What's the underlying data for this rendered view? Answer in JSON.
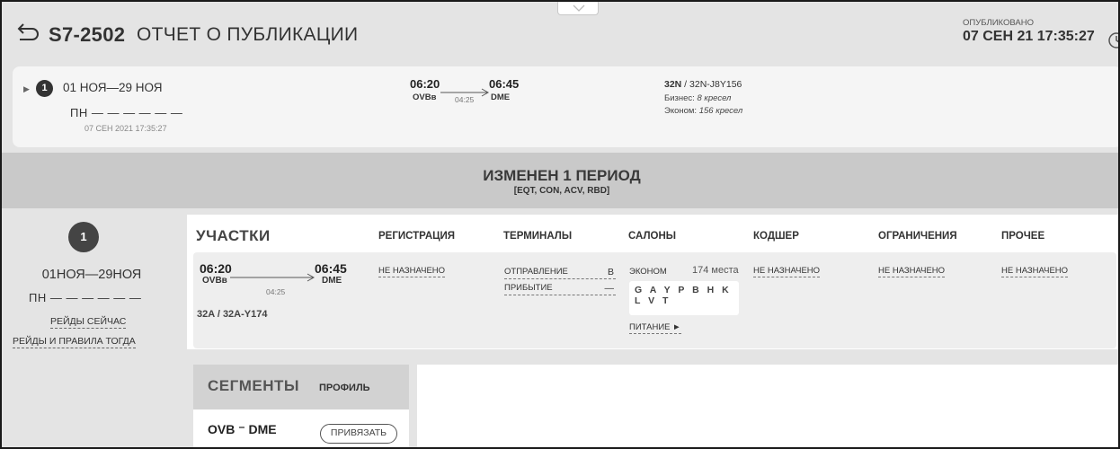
{
  "header": {
    "flight_code": "S7-2502",
    "title": "ОТЧЕТ О ПУБЛИКАЦИИ",
    "published_label": "ОПУБЛИКОВАНО",
    "published_date": "07 СЕН 21 17:35:27"
  },
  "period_card": {
    "number": "1",
    "dates": "01 НОЯ—29 НОЯ",
    "days": "ПН — — — — — —",
    "published": "07 СЕН 2021 17:35:27",
    "departure_time": "06:20",
    "departure_airport": "OVBв",
    "duration": "04:25",
    "arrival_time": "06:45",
    "arrival_airport": "DME",
    "aircraft_code": "32N",
    "aircraft_config": " / 32N-J8Y156",
    "business_label": "Бизнес: ",
    "business_value": "8 кресел",
    "economy_label": "Эконом: ",
    "economy_value": "156 кресел"
  },
  "changes": {
    "title": "ИЗМЕНЕН 1 ПЕРИОД",
    "codes": "[EQT, CON, ACV, RBD]"
  },
  "period": {
    "number": "1",
    "dates": "01НОЯ—29НОЯ",
    "days": "ПН — — — — — —",
    "flights_now": "РЕЙДЫ СЕЙЧАС",
    "flights_then": "РЕЙДЫ И ПРАВИЛА ТОГДА"
  },
  "columns": {
    "legs": "УЧАСТКИ",
    "checkin": "РЕГИСТРАЦИЯ",
    "terminals": "ТЕРМИНАЛЫ",
    "cabins": "САЛОНЫ",
    "codeshare": "КОДШЕР",
    "restrictions": "ОГРАНИЧЕНИЯ",
    "other": "ПРОЧЕЕ"
  },
  "leg": {
    "departure_time": "06:20",
    "departure_airport": "OVBв",
    "duration": "04:25",
    "arrival_time": "06:45",
    "arrival_airport": "DME",
    "aircraft": "32A / 32A-Y174",
    "checkin": "НЕ НАЗНАЧЕНО",
    "terminal_departure_label": "ОТПРАВЛЕНИЕ",
    "terminal_departure_value": "B",
    "terminal_arrival_label": "ПРИБЫТИЕ",
    "terminal_arrival_value": "—",
    "cabin_name": "ЭКОНОМ",
    "cabin_seats": "174 места",
    "rbd": "G A Y P B H K L V T",
    "meal": "ПИТАНИЕ ►",
    "codeshare": "НЕ НАЗНАЧЕНО",
    "restrictions": "НЕ НАЗНАЧЕНО",
    "other": "НЕ НАЗНАЧЕНО"
  },
  "segments": {
    "tab_segments": "СЕГМЕНТЫ",
    "tab_profile": "ПРОФИЛЬ",
    "pair": "OVB ⁻ DME",
    "bind_button": "ПРИВЯЗАТЬ"
  }
}
